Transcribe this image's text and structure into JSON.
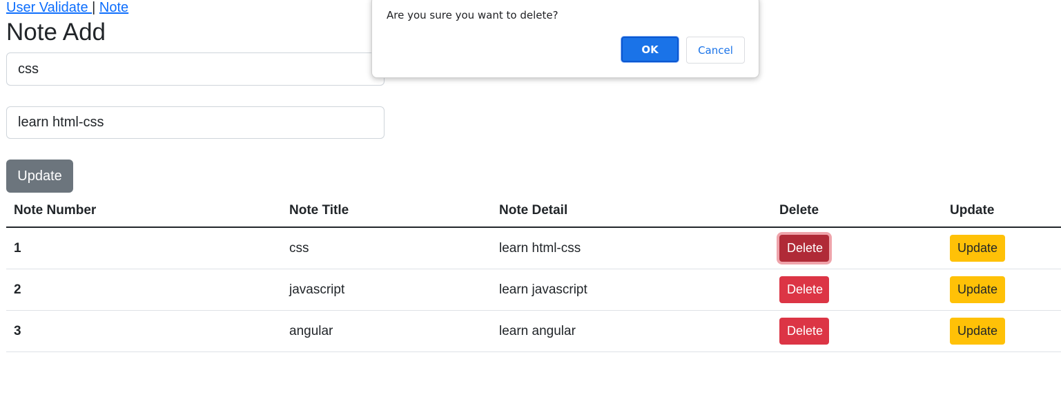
{
  "nav": {
    "link_user_validate": "User Validate ",
    "separator": "|",
    "link_note": "Note"
  },
  "page_title": "Note Add",
  "form": {
    "title_value": "css",
    "detail_value": "learn html-css",
    "update_label": "Update"
  },
  "table": {
    "headers": [
      "Note Number",
      "Note Title",
      "Note Detail",
      "Delete",
      "Update"
    ],
    "rows": [
      {
        "number": "1",
        "title": "css",
        "detail": "learn html-css",
        "delete_label": "Delete",
        "update_label": "Update"
      },
      {
        "number": "2",
        "title": "javascript",
        "detail": "learn javascript",
        "delete_label": "Delete",
        "update_label": "Update"
      },
      {
        "number": "3",
        "title": "angular",
        "detail": "learn angular",
        "delete_label": "Delete",
        "update_label": "Update"
      }
    ]
  },
  "dialog": {
    "message": "Are you sure you want to delete?",
    "ok_label": "OK",
    "cancel_label": "Cancel"
  },
  "colors": {
    "link": "#0d6efd",
    "danger": "#dc3545",
    "warning": "#ffc107",
    "secondary": "#6c757d",
    "dialog_primary": "#1a73e8"
  }
}
